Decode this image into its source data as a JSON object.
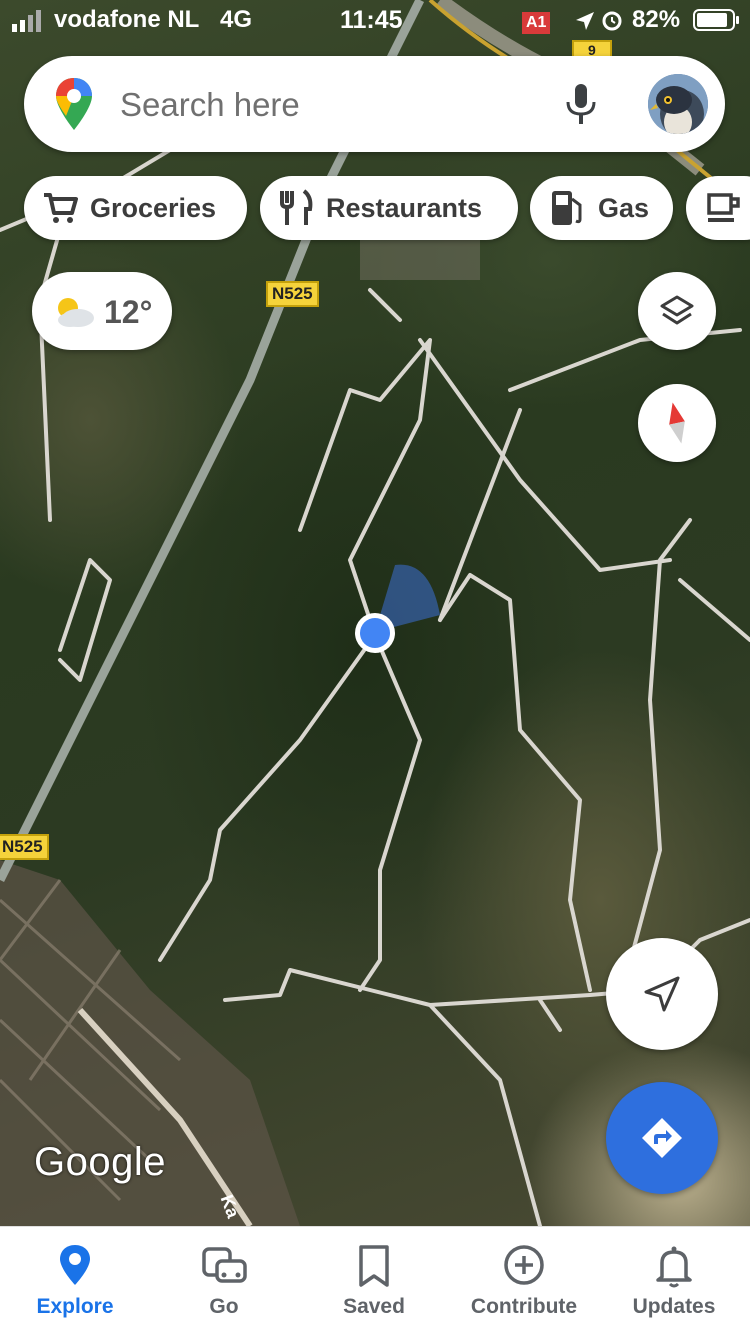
{
  "status_bar": {
    "carrier": "vodafone NL",
    "network": "4G",
    "time": "11:45",
    "battery": "82%",
    "map_route_label": "A1",
    "map_route_label_2": "9"
  },
  "search": {
    "placeholder": "Search here",
    "mic_icon": "mic-icon",
    "avatar_icon": "falcon-avatar"
  },
  "chips": [
    {
      "label": "Groceries",
      "icon": "cart-icon"
    },
    {
      "label": "Restaurants",
      "icon": "fork-knife-icon"
    },
    {
      "label": "Gas",
      "icon": "gas-pump-icon"
    },
    {
      "label": "",
      "icon": "coffee-icon"
    }
  ],
  "weather": {
    "temp": "12°",
    "icon": "partly-cloudy-icon"
  },
  "map": {
    "road_labels": [
      "N525",
      "N525"
    ],
    "attribution": "Google",
    "street_fragment": "Ka"
  },
  "controls": {
    "layers_icon": "layers-icon",
    "compass_icon": "compass-icon",
    "location_icon": "my-location-icon",
    "directions_icon": "directions-icon"
  },
  "colors": {
    "accent": "#1a73e8",
    "directions_fab": "#2e6fde",
    "location_dot": "#4285f4",
    "road_shield": "#f5d33b"
  },
  "bottom_nav": [
    {
      "label": "Explore",
      "icon": "explore-pin-icon",
      "active": true
    },
    {
      "label": "Go",
      "icon": "commute-icon",
      "active": false
    },
    {
      "label": "Saved",
      "icon": "bookmark-icon",
      "active": false
    },
    {
      "label": "Contribute",
      "icon": "add-circle-icon",
      "active": false
    },
    {
      "label": "Updates",
      "icon": "bell-icon",
      "active": false
    }
  ]
}
